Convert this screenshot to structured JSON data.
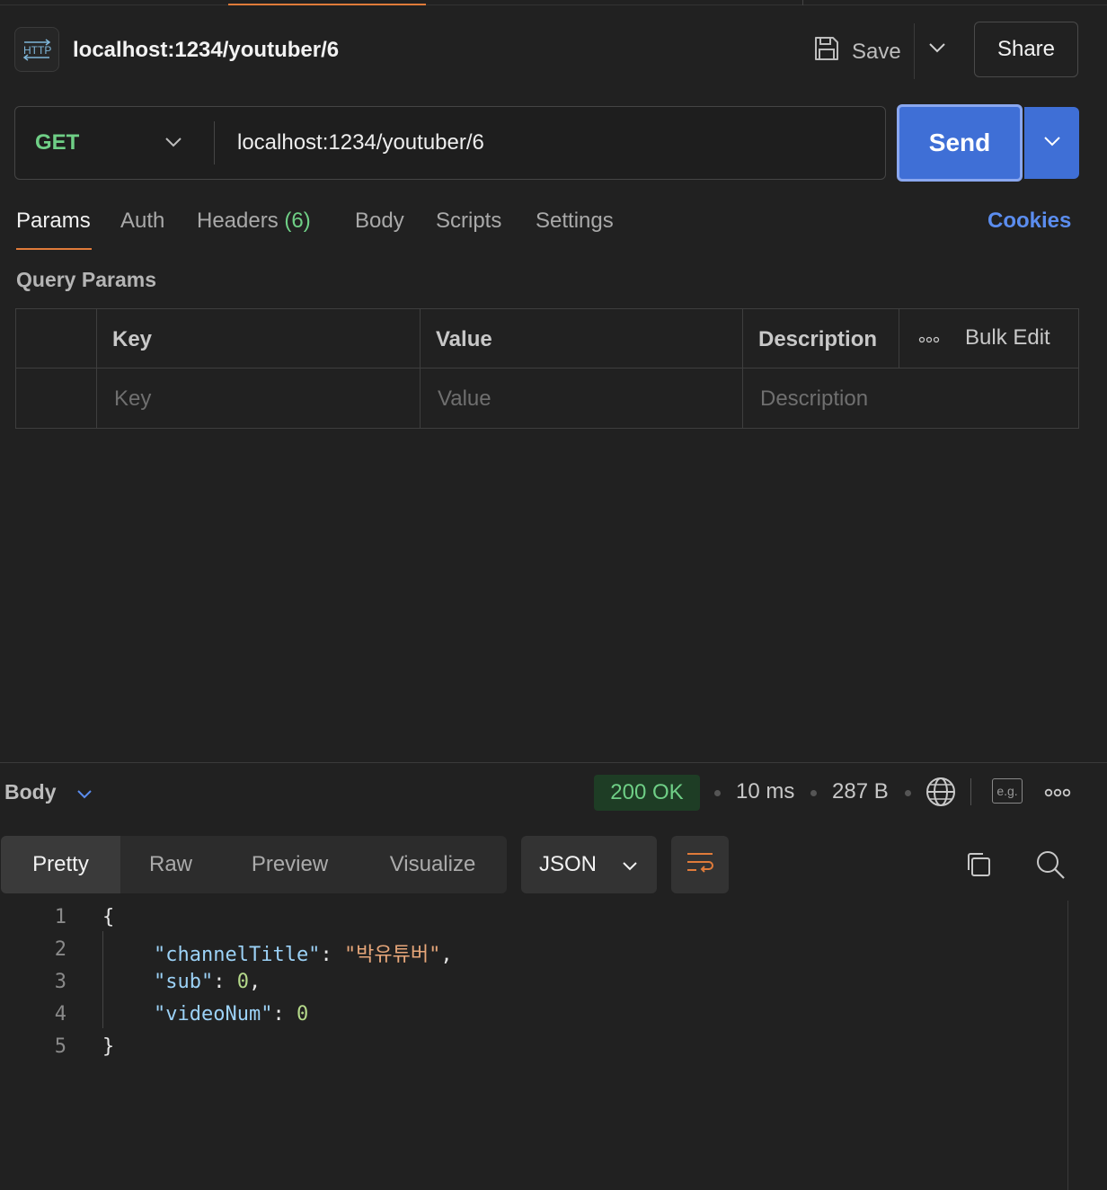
{
  "request": {
    "title": "localhost:1234/youtuber/6",
    "method": "GET",
    "url": "localhost:1234/youtuber/6"
  },
  "header": {
    "save_label": "Save",
    "share_label": "Share",
    "http_icon_text": "HTTP"
  },
  "send": {
    "label": "Send"
  },
  "tabs": [
    {
      "label": "Params",
      "active": true
    },
    {
      "label": "Auth"
    },
    {
      "label": "Headers",
      "count": "(6)"
    },
    {
      "label": "Body"
    },
    {
      "label": "Scripts"
    },
    {
      "label": "Settings"
    }
  ],
  "cookies_label": "Cookies",
  "query_params": {
    "title": "Query Params",
    "columns": [
      "Key",
      "Value",
      "Description"
    ],
    "bulk_edit": "Bulk Edit",
    "placeholders": {
      "key": "Key",
      "value": "Value",
      "description": "Description"
    }
  },
  "response": {
    "body_label": "Body",
    "status": "200 OK",
    "time": "10 ms",
    "size": "287 B",
    "eg_label": "e.g.",
    "view_tabs": [
      "Pretty",
      "Raw",
      "Preview",
      "Visualize"
    ],
    "active_view": "Pretty",
    "format": "JSON",
    "line_numbers": [
      "1",
      "2",
      "3",
      "4",
      "5"
    ],
    "code": {
      "open": "{",
      "close": "}",
      "lines": [
        {
          "key": "\"channelTitle\"",
          "value": "\"박유튜버\"",
          "value_type": "string",
          "comma": ","
        },
        {
          "key": "\"sub\"",
          "value": "0",
          "value_type": "number",
          "comma": ","
        },
        {
          "key": "\"videoNum\"",
          "value": "0",
          "value_type": "number",
          "comma": ""
        }
      ]
    }
  },
  "colors": {
    "accent_orange": "#e07b3a",
    "send_blue": "#3f6fd6",
    "status_green": "#6fcf86",
    "cookies_blue": "#5b8def",
    "json_key": "#9cd2f7",
    "json_string": "#e7a77a",
    "json_number": "#b5d98a"
  }
}
